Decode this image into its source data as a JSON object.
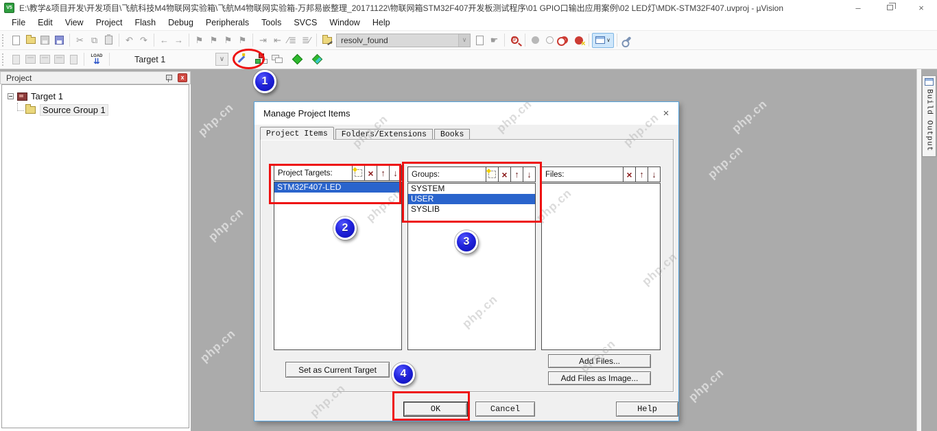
{
  "window": {
    "title": "E:\\教学&项目开发\\开发项目\\飞航科技M4物联网实验箱\\飞航M4物联网实验箱-万邦易嵌整理_20171122\\物联网箱STM32F407开发板测试程序\\01 GPIO口输出应用案例\\02 LED灯\\MDK-STM32F407.uvproj - µVision",
    "app_badge": "V5"
  },
  "menu": {
    "items": [
      "File",
      "Edit",
      "View",
      "Project",
      "Flash",
      "Debug",
      "Peripherals",
      "Tools",
      "SVCS",
      "Window",
      "Help"
    ]
  },
  "toolbar": {
    "find_value": "resolv_found",
    "target_value": "Target 1",
    "load_label": "LOAD"
  },
  "project_panel": {
    "title": "Project",
    "target": "Target 1",
    "source_group": "Source Group 1"
  },
  "build_output": {
    "label": "Build Output"
  },
  "dialog": {
    "title": "Manage Project Items",
    "tabs": [
      "Project Items",
      "Folders/Extensions",
      "Books"
    ],
    "project_targets": {
      "label": "Project Targets:",
      "items": [
        "STM32F407-LED"
      ],
      "selected": "STM32F407-LED"
    },
    "groups": {
      "label": "Groups:",
      "items": [
        "SYSTEM",
        "USER",
        "SYSLIB"
      ],
      "selected": "USER"
    },
    "files": {
      "label": "Files:"
    },
    "buttons": {
      "set_current": "Set as Current Target",
      "add_files": "Add Files...",
      "add_files_image": "Add Files as Image...",
      "ok": "OK",
      "cancel": "Cancel",
      "help": "Help"
    }
  },
  "annotations": {
    "badge1": "1",
    "badge2": "2",
    "badge3": "3",
    "badge4": "4"
  },
  "watermark": {
    "text": "php.cn"
  },
  "icons": {
    "minimize": "–",
    "close": "×",
    "panel_close": "x",
    "dialog_close": "×",
    "delete": "×",
    "up": "↑",
    "down": "↓",
    "dropdown": "∨",
    "cut": "✂",
    "copy": "⧉",
    "undo": "↶",
    "redo": "↷",
    "back": "←",
    "forward": "→",
    "flag": "⚑",
    "indent": "⇥",
    "unindent": "⇤",
    "comment": "∕≣",
    "uncomment": "≣∕",
    "grab": "☛",
    "dot": "●",
    "ring": "○",
    "at": "@",
    "load_arrows": "⇊"
  },
  "colors": {
    "annotation_red": "#ee1111",
    "badge_blue": "#1c1ecf",
    "selection_blue": "#2a64cc",
    "workspace_gray": "#ababab",
    "dialog_border": "#58a6e0"
  }
}
